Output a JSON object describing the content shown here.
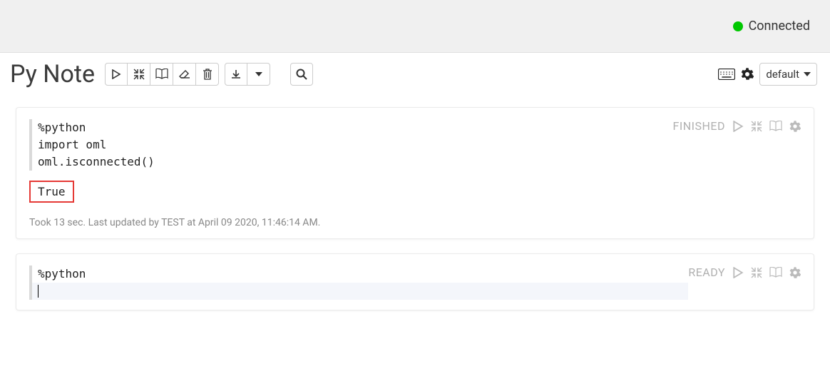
{
  "header": {
    "status_label": "Connected",
    "status_color": "#00c800"
  },
  "notebook": {
    "title": "Py Note",
    "interpreter_selection": "default"
  },
  "toolbar": {
    "icons": {
      "run": "run-all-icon",
      "collapse": "collapse-icon",
      "book": "book-icon",
      "eraser": "eraser-icon",
      "trash": "trash-icon",
      "download": "download-icon",
      "caret": "caret-down-icon",
      "search": "search-icon",
      "keyboard": "keyboard-icon",
      "gear": "gear-icon"
    }
  },
  "paragraphs": [
    {
      "status": "FINISHED",
      "code": "%python\nimport oml\noml.isconnected()",
      "output": "True",
      "meta": "Took 13 sec. Last updated by TEST at April 09 2020, 11:46:14 AM."
    },
    {
      "status": "READY",
      "code": "%python",
      "output": "",
      "meta": ""
    }
  ]
}
